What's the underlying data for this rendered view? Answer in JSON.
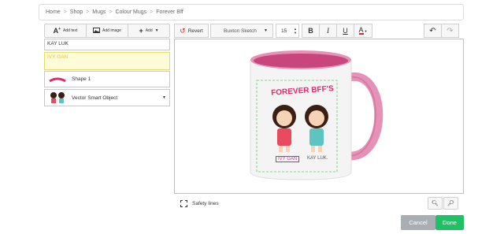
{
  "breadcrumb": [
    "Home",
    "Shop",
    "Mugs",
    "Colour Mugs",
    "Forever Bff"
  ],
  "left_toolbar": {
    "add_text": "Add text",
    "add_image": "Add image",
    "add": "Add"
  },
  "layers": {
    "layer1": "KAY LUK",
    "layer2": "IVY GAN",
    "layer3": "Shape 1",
    "layer4": "Vector Smart Object"
  },
  "toolbar": {
    "revert": "Revert",
    "font": "Buxton Sketch",
    "font_size": "15",
    "bold": "B",
    "italic": "I",
    "underline": "U",
    "color_letter": "A"
  },
  "design": {
    "title": "FOREVER BFF'S",
    "name_left": "IVY GAN",
    "name_right": "KAY LUK."
  },
  "safety_label": "Safety lines",
  "buttons": {
    "cancel": "Cancel",
    "done": "Done"
  },
  "colors": {
    "mug_pink": "#e692b6",
    "title_pink": "#e6286e",
    "done_green": "#1ec265",
    "cancel_grey": "#a9aeb3",
    "selected_fill": "#fdfbd8"
  }
}
